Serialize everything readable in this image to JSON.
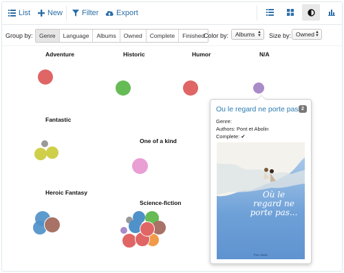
{
  "toolbar": {
    "list_label": "List",
    "new_label": "New",
    "filter_label": "Filter",
    "export_label": "Export",
    "icons": [
      "list-icon",
      "plus-icon",
      "filter-icon",
      "cloud-upload-icon",
      "list-view-icon",
      "grid-view-icon",
      "contrast-icon",
      "bar-chart-icon"
    ]
  },
  "controls": {
    "group_by_label": "Group by:",
    "group_options": [
      "Genre",
      "Language",
      "Albums",
      "Owned",
      "Complete",
      "Finished"
    ],
    "group_selected": "Genre",
    "color_by_label": "Color by:",
    "color_value": "Albums",
    "size_by_label": "Size by:",
    "size_value": "Owned"
  },
  "groups": {
    "adventure": "Adventure",
    "historic": "Historic",
    "humor": "Humor",
    "na": "N/A",
    "fantastic": "Fantastic",
    "one_of_a_kind": "One of a kind",
    "heroic_fantasy": "Heroic Fantasy",
    "science_fiction": "Science-fiction"
  },
  "colors": {
    "red": "#e06565",
    "green": "#66bb55",
    "purple": "#a98bc9",
    "olive": "#cfcf4a",
    "gray": "#999999",
    "pink": "#e99ed4",
    "blue": "#4f91c9",
    "brown": "#a87266",
    "orange": "#f09a4a",
    "accent": "#2a6da8"
  },
  "popover": {
    "title": "Ou le regard ne porte pas",
    "badge": "2",
    "genre_label": "Genre:",
    "authors_label": "Authors:",
    "authors_value": "Pont et Abolin",
    "complete_label": "Complete:",
    "complete_mark": "✔",
    "cover_text": "Où le regard ne porte pas...",
    "cover_credit": "Pont • Abolin"
  }
}
